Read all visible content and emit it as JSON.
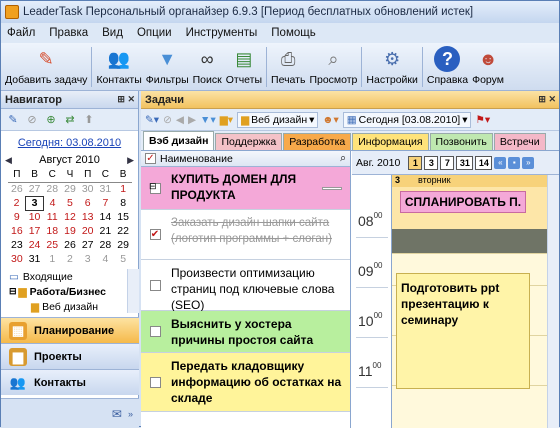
{
  "window": {
    "title": "LeaderTask Персональный органайзер 6.9.3 [Период бесплатных обновлений истек]"
  },
  "menu": [
    "Файл",
    "Правка",
    "Вид",
    "Опции",
    "Инструменты",
    "Помощь"
  ],
  "toolbar": [
    {
      "label": "Добавить задачу",
      "icon": "add-task-icon",
      "color": "#d64a2a"
    },
    {
      "label": "Контакты",
      "icon": "contacts-icon",
      "color": "#d07830"
    },
    {
      "label": "Фильтры",
      "icon": "filter-icon",
      "color": "#4a8fd6"
    },
    {
      "label": "Поиск",
      "icon": "binoculars-icon",
      "color": "#333"
    },
    {
      "label": "Отчеты",
      "icon": "reports-icon",
      "color": "#3a8a3a"
    },
    {
      "label": "Печать",
      "icon": "printer-icon",
      "color": "#666"
    },
    {
      "label": "Просмотр",
      "icon": "preview-icon",
      "color": "#777"
    },
    {
      "label": "Настройки",
      "icon": "settings-icon",
      "color": "#4a6fae"
    },
    {
      "label": "Справка",
      "icon": "help-icon",
      "color": "#2a5fc0"
    },
    {
      "label": "Форум",
      "icon": "forum-icon",
      "color": "#c04a3a"
    }
  ],
  "navigator": {
    "title": "Навигатор",
    "today_link": "Сегодня: 03.08.2010",
    "month": "Август 2010",
    "weekdays": [
      "П",
      "В",
      "С",
      "Ч",
      "П",
      "С",
      "В"
    ],
    "weeks": [
      [
        "26",
        "27",
        "28",
        "29",
        "30",
        "31",
        "1"
      ],
      [
        "2",
        "3",
        "4",
        "5",
        "6",
        "7",
        "8"
      ],
      [
        "9",
        "10",
        "11",
        "12",
        "13",
        "14",
        "15"
      ],
      [
        "16",
        "17",
        "18",
        "19",
        "20",
        "21",
        "22"
      ],
      [
        "23",
        "24",
        "25",
        "26",
        "27",
        "28",
        "29"
      ],
      [
        "30",
        "31",
        "1",
        "2",
        "3",
        "4",
        "5"
      ]
    ],
    "tree": [
      "Входящие",
      "Работа/Бизнес",
      "Веб дизайн"
    ],
    "sections": [
      "Планирование",
      "Проекты",
      "Контакты"
    ]
  },
  "tasks": {
    "title": "Задачи",
    "project_filter": "Веб дизайн",
    "date_filter": "Сегодня [03.08.2010]",
    "tabs": [
      {
        "label": "Вэб дизайн",
        "color": "#ffffff",
        "text": "#000"
      },
      {
        "label": "Поддержка",
        "color": "#f4c2c8",
        "text": "#000"
      },
      {
        "label": "Разработка",
        "color": "#f7a94a",
        "text": "#000"
      },
      {
        "label": "Информация",
        "color": "#ffe37a",
        "text": "#000"
      },
      {
        "label": "Позвонить",
        "color": "#bfe8b0",
        "text": "#000"
      },
      {
        "label": "Встречи",
        "color": "#f4b8c8",
        "text": "#000"
      }
    ],
    "column_header": "Наименование",
    "items": [
      {
        "text": "КУПИТЬ ДОМЕН ДЛЯ ПРОДУКТА",
        "bg": "#f4a8d8",
        "checked": false
      },
      {
        "text": "Заказать дизайн шапки сайта (логотип программы + слоган)",
        "bg": "#ffffff",
        "checked": true
      },
      {
        "text": "Произвести оптимизацию страниц под ключевые слова (SEO)",
        "bg": "#ffffff",
        "checked": false
      },
      {
        "text": "Выяснить у хостера причины простоя сайта",
        "bg": "#b8ef9e",
        "checked": false
      },
      {
        "text": "Передать кладовщику информацию об остатках на складе",
        "bg": "#fff49a",
        "checked": false
      }
    ]
  },
  "calendar": {
    "date_label": "Авг. 2010",
    "view_buttons": [
      "1",
      "3",
      "7",
      "31",
      "14"
    ],
    "day_number": "3",
    "day_name": "вторник",
    "allday_task": "СПЛАНИРОВАТЬ П.",
    "hours": [
      "08",
      "09",
      "10",
      "11"
    ],
    "minutes": "00",
    "event": "Подготовить ppt презентацию к семинару"
  }
}
